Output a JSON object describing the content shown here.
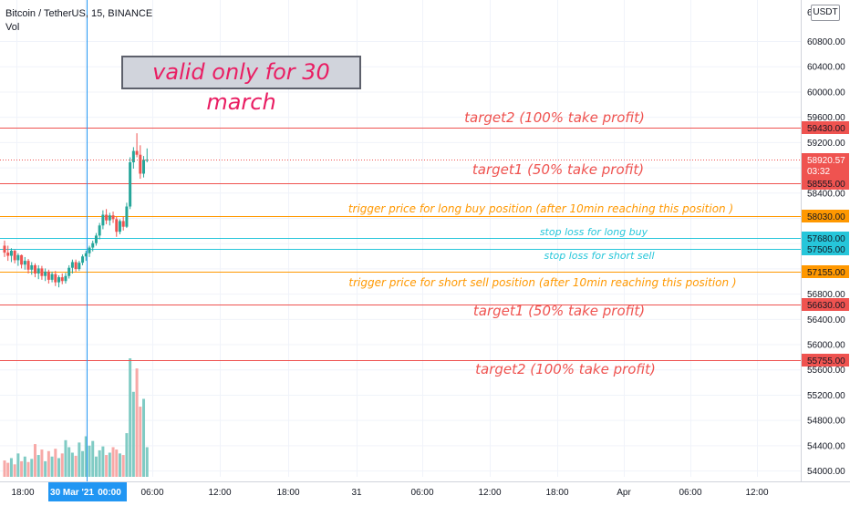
{
  "header": {
    "symbol_title": "Bitcoin / TetherUS, 15, BINANCE",
    "volume_label": "Vol",
    "currency_badge": "USDT"
  },
  "note": {
    "text": "valid only for 30 march"
  },
  "chart_data": {
    "type": "candlestick",
    "y_axis": {
      "ticks": [
        54000,
        54400,
        54800,
        55200,
        55600,
        56000,
        56400,
        56800,
        57200,
        57600,
        58000,
        58400,
        58800,
        59200,
        59600,
        60000,
        60400,
        60800
      ],
      "tick_labels": [
        "54000.00",
        "54400.00",
        "54800.00",
        "55200.00",
        "55600.00",
        "56000.00",
        "56400.00",
        "56800.00",
        "57200.00",
        "57600.00",
        "58000.00",
        "58400.00",
        "58800.00",
        "59200.00",
        "59600.00",
        "60000.00",
        "60400.00",
        "60800.00"
      ],
      "top_clipped_label": "6",
      "range": [
        53900,
        61450
      ]
    },
    "x_axis": {
      "labels": [
        "18:00",
        "30 Mar '21",
        "00:00",
        "06:00",
        "12:00",
        "18:00",
        "31",
        "06:00",
        "12:00",
        "18:00",
        "Apr",
        "06:00",
        "12:00"
      ],
      "highlight_labels": [
        "30 Mar '21",
        "00:00"
      ]
    },
    "current_price": {
      "value": "58920.57",
      "countdown": "03:32",
      "color": "#ef5350"
    },
    "price_lines": [
      {
        "price": 59430,
        "label": "59430.00",
        "color": "#ef5350",
        "text": "target2 (100% take profit)",
        "text_size": 15
      },
      {
        "price": 58555,
        "label": "58555.00",
        "color": "#ef5350",
        "text": "target1 (50% take profit)",
        "text_size": 15
      },
      {
        "price": 58030,
        "label": "58030.00",
        "color": "#ff9800",
        "text": "trigger price for long buy position (after 10min reaching this position )",
        "text_size": 12
      },
      {
        "price": 57680,
        "label": "57680.00",
        "color": "#26c6da",
        "text": "stop loss for long buy",
        "text_size": 11
      },
      {
        "price": 57505,
        "label": "57505.00",
        "color": "#26c6da",
        "text": "stop loss for short sell",
        "text_size": 11
      },
      {
        "price": 57155,
        "label": "57155.00",
        "color": "#ff9800",
        "text": "trigger price for short sell position (after 10min reaching this position )",
        "text_size": 12
      },
      {
        "price": 56630,
        "label": "56630.00",
        "color": "#ef5350",
        "text": "target1 (50% take profit)",
        "text_size": 15
      },
      {
        "price": 55755,
        "label": "55755.00",
        "color": "#ef5350",
        "text": "target2 (100% take profit)",
        "text_size": 15
      }
    ],
    "candles": [
      [
        57560,
        57640,
        57380,
        57450
      ],
      [
        57450,
        57560,
        57320,
        57400
      ],
      [
        57400,
        57520,
        57300,
        57480
      ],
      [
        57480,
        57500,
        57280,
        57330
      ],
      [
        57330,
        57440,
        57240,
        57410
      ],
      [
        57410,
        57420,
        57200,
        57260
      ],
      [
        57260,
        57380,
        57180,
        57320
      ],
      [
        57320,
        57350,
        57120,
        57180
      ],
      [
        57180,
        57300,
        57100,
        57250
      ],
      [
        57250,
        57280,
        57060,
        57120
      ],
      [
        57120,
        57250,
        57030,
        57200
      ],
      [
        57200,
        57240,
        57020,
        57080
      ],
      [
        57080,
        57200,
        57000,
        57150
      ],
      [
        57150,
        57180,
        56960,
        57020
      ],
      [
        57020,
        57150,
        56980,
        57110
      ],
      [
        57110,
        57160,
        56920,
        56980
      ],
      [
        56980,
        57090,
        56900,
        57060
      ],
      [
        57060,
        57120,
        56950,
        57000
      ],
      [
        57000,
        57130,
        56960,
        57080
      ],
      [
        57080,
        57250,
        57040,
        57210
      ],
      [
        57210,
        57340,
        57120,
        57300
      ],
      [
        57300,
        57340,
        57150,
        57190
      ],
      [
        57190,
        57320,
        57160,
        57290
      ],
      [
        57290,
        57420,
        57250,
        57390
      ],
      [
        57390,
        57480,
        57320,
        57440
      ],
      [
        57440,
        57560,
        57380,
        57530
      ],
      [
        57530,
        57640,
        57470,
        57600
      ],
      [
        57600,
        57760,
        57560,
        57720
      ],
      [
        57720,
        57920,
        57660,
        57880
      ],
      [
        57880,
        58120,
        57820,
        58050
      ],
      [
        58050,
        58140,
        57900,
        57960
      ],
      [
        57960,
        58080,
        57880,
        58040
      ],
      [
        58040,
        58100,
        57920,
        57980
      ],
      [
        57980,
        58020,
        57700,
        57780
      ],
      [
        57780,
        57980,
        57740,
        57950
      ],
      [
        57950,
        58020,
        57800,
        57860
      ],
      [
        57860,
        58240,
        57840,
        58180
      ],
      [
        58180,
        58960,
        58140,
        58880
      ],
      [
        58880,
        59120,
        58780,
        59060
      ],
      [
        59060,
        59340,
        58960,
        59000
      ],
      [
        59000,
        59150,
        58620,
        58700
      ],
      [
        58700,
        58980,
        58640,
        58920
      ],
      [
        58920,
        59100,
        58880,
        58921
      ]
    ],
    "volumes": [
      210,
      180,
      240,
      160,
      300,
      200,
      260,
      190,
      230,
      420,
      280,
      350,
      200,
      330,
      260,
      360,
      240,
      300,
      470,
      380,
      310,
      270,
      440,
      330,
      520,
      400,
      460,
      260,
      340,
      390,
      280,
      310,
      380,
      350,
      300,
      280,
      560,
      1520,
      1090,
      1390,
      900,
      1000,
      380
    ],
    "volume_max": 1520
  },
  "colors": {
    "up": "#26a69a",
    "down": "#ef5350",
    "volume_up": "#80cbc4",
    "volume_down": "#f7a9a7",
    "crosshair": "#2196f3",
    "grid": "#f0f3fa",
    "axis_text": "#131722",
    "note_text": "#e91e63"
  }
}
